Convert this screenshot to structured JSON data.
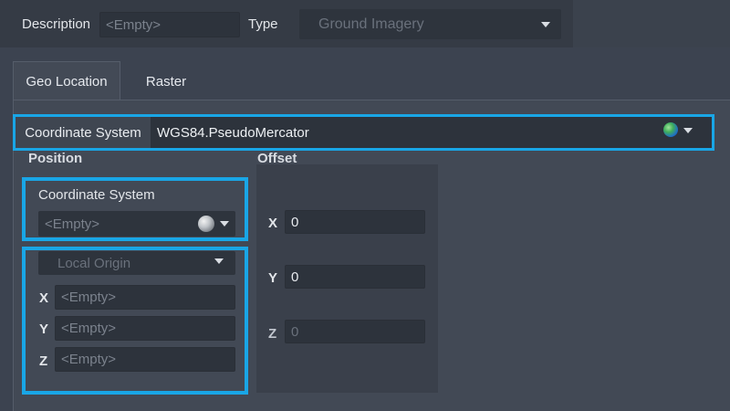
{
  "top": {
    "description_label": "Description",
    "description_placeholder": "<Empty>",
    "type_label": "Type",
    "type_value": "Ground Imagery"
  },
  "tabs": [
    {
      "label": "Geo Location",
      "active": true
    },
    {
      "label": "Raster",
      "active": false
    }
  ],
  "coordinate_system": {
    "label": "Coordinate System",
    "value": "WGS84.PseudoMercator",
    "icon": "globe-icon"
  },
  "position": {
    "title": "Position",
    "cs_label": "Coordinate System",
    "cs_value": "<Empty>",
    "cs_icon": "sphere-icon",
    "origin_dropdown": "Local Origin",
    "fields": [
      {
        "label": "X",
        "value": "<Empty>"
      },
      {
        "label": "Y",
        "value": "<Empty>"
      },
      {
        "label": "Z",
        "value": "<Empty>"
      }
    ]
  },
  "offset": {
    "title": "Offset",
    "fields": [
      {
        "label": "X",
        "value": "0",
        "enabled": true
      },
      {
        "label": "Y",
        "value": "0",
        "enabled": true
      },
      {
        "label": "Z",
        "value": "0",
        "enabled": false
      }
    ]
  },
  "colors": {
    "highlight": "#19a6e6",
    "background": "#3c4350",
    "field": "#2d333c"
  }
}
